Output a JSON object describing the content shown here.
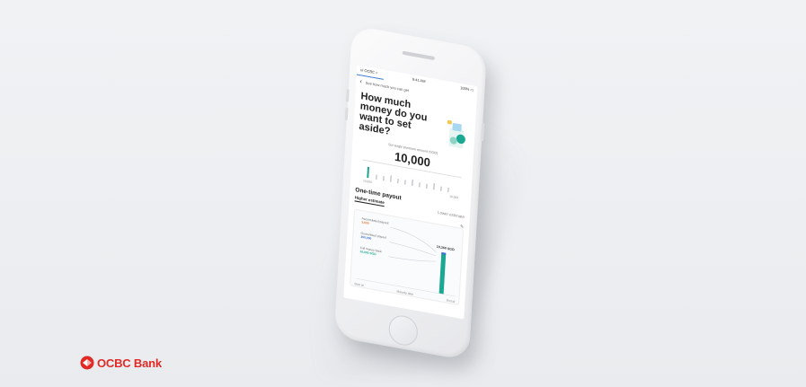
{
  "status_bar": {
    "carrier": "ııl OCBC ≈",
    "time": "9:41 AM",
    "battery": "100% ▭"
  },
  "header": {
    "back_icon": "chevron-left-icon",
    "subtitle": "See how much you can get"
  },
  "question": {
    "title": "How much money do you want to set aside?"
  },
  "amount": {
    "label": "Set single premium amount (SGD)",
    "value": "10,000",
    "min_label": "10,000",
    "max_label": "10,000",
    "edit_icon": "pencil-icon"
  },
  "payout": {
    "title": "One-time payout",
    "tabs": [
      "Higher estimate",
      "Lower estimate"
    ]
  },
  "chart_card": {
    "legend": [
      {
        "label": "Accumulated payout",
        "value": "3,600",
        "color": "#e8763a"
      },
      {
        "label": "Guaranteed payout",
        "value": "300,000",
        "color": "#3e6fd8"
      },
      {
        "label": "Full money back",
        "value": "10,000 SGD",
        "color": "#1aa893"
      }
    ],
    "total": "10,360 SGD",
    "axis": [
      "Start at",
      "Maturity date",
      "End of"
    ]
  },
  "brand": {
    "name": "OCBC Bank",
    "color": "#e12a26"
  },
  "colors": {
    "accent": "#3e7bd8",
    "teal": "#1aa893",
    "brand_red": "#e12a26"
  }
}
